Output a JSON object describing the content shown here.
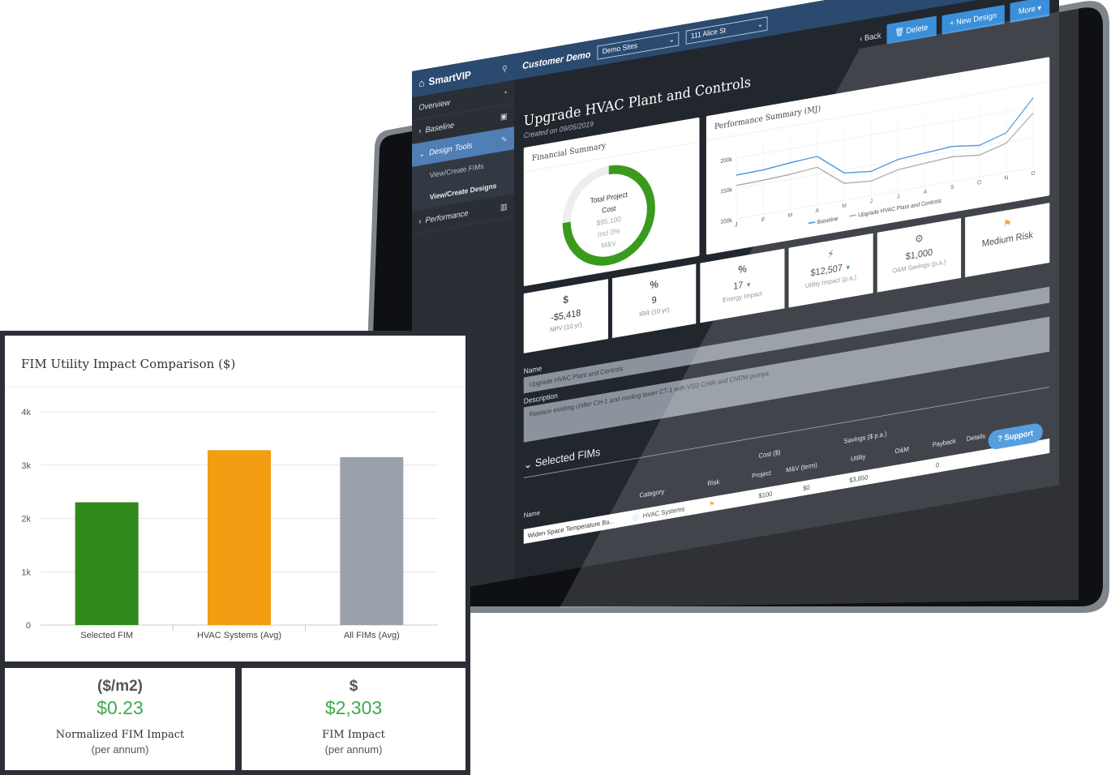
{
  "app": {
    "brand": "SmartVIP",
    "customer": "Customer Demo",
    "site_select": "Demo Sites",
    "address_select": "111 Alice St",
    "sidebar": [
      {
        "label": "Overview",
        "icon": "dashboard-icon"
      },
      {
        "label": "Baseline",
        "icon": "cube-icon"
      },
      {
        "label": "Design Tools",
        "icon": "pencil-icon"
      },
      {
        "label": "View/Create FIMs"
      },
      {
        "label": "View/Create Designs"
      },
      {
        "label": "Performance",
        "icon": "building-icon"
      }
    ],
    "actions": {
      "back": "Back",
      "delete": "Delete",
      "new_design": "New Design",
      "more": "More"
    },
    "page_title": "Upgrade HVAC Plant and Controls",
    "created": "Created on 09/05/2019",
    "financial_summary": {
      "title": "Financial Summary",
      "gauge_label_1": "Total Project",
      "gauge_label_2": "Cost",
      "gauge_value": "$95,100",
      "gauge_note": "Incl 0%",
      "gauge_note2": "M&V",
      "gauge_fraction": 0.75
    },
    "performance_summary": {
      "title": "Performance Summary (MJ)",
      "ytick_labels": [
        "200k",
        "150k",
        "100k"
      ],
      "months": [
        "J",
        "F",
        "M",
        "A",
        "M",
        "J",
        "J",
        "A",
        "S",
        "O",
        "N",
        "D"
      ],
      "legend": [
        "Baseline",
        "Upgrade HVAC Plant and Controls"
      ]
    },
    "kpis": [
      {
        "icon": "$",
        "value": "-$5,418",
        "label": "NPV (10 yr)"
      },
      {
        "icon": "%",
        "value": "9",
        "label": "IRR (10 yr)"
      },
      {
        "icon": "%",
        "value": "17",
        "label": "Energy Impact"
      },
      {
        "icon": "⚡",
        "value": "$12,507",
        "label": "Utility Impact (p.a.)"
      },
      {
        "icon": "⚙",
        "value": "$1,000",
        "label": "O&M Savings (p.a.)"
      },
      {
        "icon": "⚑",
        "value": "Medium Risk",
        "label": ""
      }
    ],
    "form": {
      "name_label": "Name",
      "name_value": "Upgrade HVAC Plant and Controls",
      "desc_label": "Description",
      "desc_value": "Replace existing chiller CH-1 and cooling tower CT-1 with VSD CHW and CNDW pumps"
    },
    "selected_fims": "Selected FIMs",
    "table": {
      "group_cost": "Cost ($)",
      "group_savings": "Savings ($ p.a.)",
      "cols": [
        "Name",
        "Category",
        "Risk",
        "Project",
        "M&V (term)",
        "Utility",
        "O&M",
        "Payback",
        "Details"
      ],
      "row": {
        "name": "Widen Space Temperature Ba...",
        "category": "HVAC Systems",
        "project": "$100",
        "mv": "$0",
        "utility": "$3,850",
        "payback": "0"
      }
    },
    "support": "Support"
  },
  "panel": {
    "title": "FIM Utility Impact Comparison ($)",
    "left_stat": {
      "head": "($/m2)",
      "value": "$0.23",
      "label": "Normalized FIM Impact",
      "sub": "(per annum)"
    },
    "right_stat": {
      "head": "$",
      "value": "$2,303",
      "label": "FIM Impact",
      "sub": "(per annum)"
    }
  },
  "chart_data": [
    {
      "type": "bar",
      "title": "FIM Utility Impact Comparison ($)",
      "categories": [
        "Selected FIM",
        "HVAC Systems (Avg)",
        "All FIMs (Avg)"
      ],
      "values": [
        2303,
        3280,
        3150
      ],
      "colors": [
        "#2f8a1a",
        "#f29d12",
        "#9aa1ab"
      ],
      "ylim": [
        0,
        4000
      ],
      "yticks": [
        "0",
        "1k",
        "2k",
        "3k",
        "4k"
      ],
      "grid": true
    },
    {
      "type": "line",
      "title": "Performance Summary (MJ)",
      "categories": [
        "J",
        "F",
        "M",
        "A",
        "M",
        "J",
        "J",
        "A",
        "S",
        "O",
        "N",
        "D"
      ],
      "series": [
        {
          "name": "Baseline",
          "values": [
            172,
            173,
            177,
            180,
            145,
            140,
            152,
            155,
            158,
            152,
            165,
            215
          ],
          "color": "#3b8fd9"
        },
        {
          "name": "Upgrade HVAC Plant and Controls",
          "values": [
            155,
            156,
            158,
            162,
            128,
            124,
            135,
            138,
            141,
            136,
            148,
            190
          ],
          "color": "#a6a6a6"
        }
      ],
      "ylim": [
        100,
        220
      ],
      "yticks": [
        100,
        150,
        200
      ]
    }
  ]
}
